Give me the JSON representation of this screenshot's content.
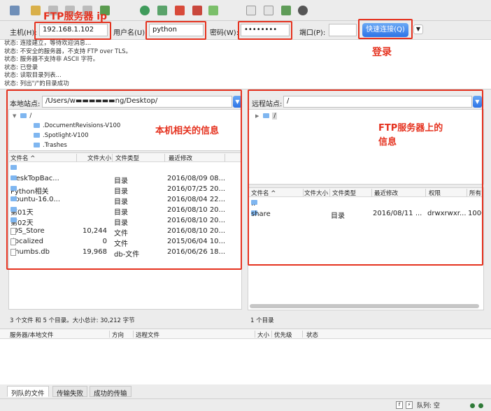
{
  "toolbar": {
    "icons": [
      "site-manager-icon",
      "refresh-icon",
      "process-queue-icon",
      "cancel-icon",
      "disconnect-icon",
      "reconnect-icon",
      "filter-icon",
      "compare-icon",
      "sync-browse-icon",
      "search-icon"
    ]
  },
  "quickconnect": {
    "host_label": "主机(H):",
    "host_value": "192.168.1.102",
    "user_label": "用户名(U):",
    "user_value": "python",
    "pass_label": "密码(W):",
    "pass_value": "••••••••",
    "port_label": "端口(P):",
    "port_value": "",
    "button_label": "快速连接(Q)"
  },
  "log": [
    "状态: 连接建立，等待欢迎消息...",
    "状态: 不安全的服务器，不支持 FTP over TLS。",
    "状态: 服务器不支持非 ASCII 字符。",
    "状态: 已登录",
    "状态: 读取目录列表...",
    "状态: 列出\"/\"的目录成功"
  ],
  "local": {
    "site_label": "本地站点:",
    "path": "/Users/w▬▬▬▬▬▬ng/Desktop/",
    "tree": [
      {
        "name": "/",
        "depth": 0
      },
      {
        "name": ".DocumentRevisions-V100",
        "depth": 1
      },
      {
        "name": ".Spotlight-V100",
        "depth": 1
      },
      {
        "name": ".Trashes",
        "depth": 1
      }
    ],
    "columns": [
      "文件名 ^",
      "文件大小",
      "文件类型",
      "最近修改"
    ],
    "files": [
      {
        "name": "..",
        "size": "",
        "type": "",
        "modified": "",
        "kind": "folder"
      },
      {
        "name": "DeskTopBac...",
        "size": "",
        "type": "目录",
        "modified": "2016/08/09 08...",
        "kind": "folder"
      },
      {
        "name": "Python相关",
        "size": "",
        "type": "目录",
        "modified": "2016/07/25 20...",
        "kind": "folder"
      },
      {
        "name": "ubuntu-16.0...",
        "size": "",
        "type": "目录",
        "modified": "2016/08/04 22...",
        "kind": "folder"
      },
      {
        "name": "第01天",
        "size": "",
        "type": "目录",
        "modified": "2016/08/10 20...",
        "kind": "folder"
      },
      {
        "name": "第02天",
        "size": "",
        "type": "目录",
        "modified": "2016/08/10 20...",
        "kind": "folder"
      },
      {
        "name": ".DS_Store",
        "size": "10,244",
        "type": "文件",
        "modified": "2016/08/10 20...",
        "kind": "file"
      },
      {
        "name": ".localized",
        "size": "0",
        "type": "文件",
        "modified": "2015/06/04 10...",
        "kind": "file"
      },
      {
        "name": "Thumbs.db",
        "size": "19,968",
        "type": "db-文件",
        "modified": "2016/06/26 18...",
        "kind": "file"
      }
    ],
    "status": "3 个文件 和 5 个目录。大小总计: 30,212 字节"
  },
  "remote": {
    "site_label": "远程站点:",
    "path": "/",
    "tree_root": "/",
    "columns": [
      "文件名 ^",
      "文件大小",
      "文件类型",
      "最近修改",
      "权限",
      "所有"
    ],
    "files": [
      {
        "name": "..",
        "size": "",
        "type": "",
        "modified": "",
        "perm": "",
        "owner": "",
        "kind": "folder"
      },
      {
        "name": "share",
        "size": "",
        "type": "目录",
        "modified": "2016/08/11 ...",
        "perm": "drwxrwxr...",
        "owner": "1000",
        "kind": "folder"
      }
    ],
    "status": "1 个目录"
  },
  "queue": {
    "columns": [
      "服务器/本地文件",
      "方向",
      "远程文件",
      "大小",
      "优先级",
      "状态"
    ],
    "tabs": [
      "列队的文件",
      "传输失败",
      "成功的传输"
    ],
    "status": "队列: 空"
  },
  "annotations": {
    "ip": "FTP服务器 ip",
    "login": "登录",
    "local_info": "本机相关的信息",
    "remote_info_1": "FTP服务器上的",
    "remote_info_2": "信息"
  },
  "colors": {
    "annotation_red": "#e5321f",
    "accent_blue": "#2d73e6",
    "folder_blue": "#7fb6f0"
  }
}
